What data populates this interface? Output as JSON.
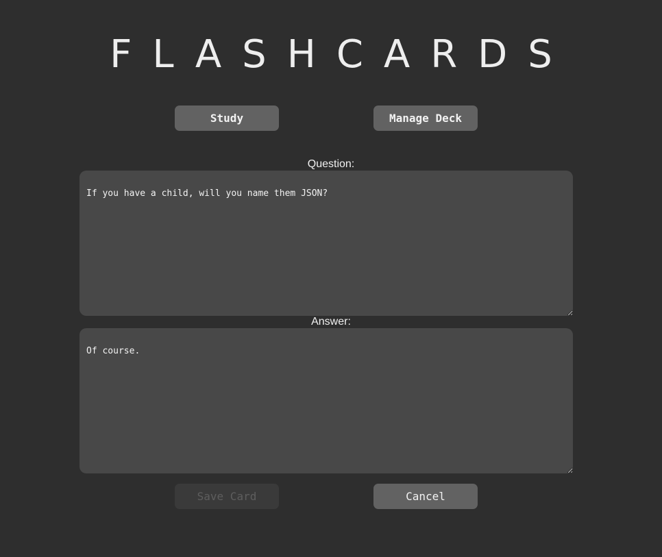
{
  "app": {
    "title": "FLASHCARDS"
  },
  "nav": {
    "study_label": "Study",
    "manage_label": "Manage Deck"
  },
  "form": {
    "question_label": "Question:",
    "question_value": "If you have a child, will you name them JSON?",
    "answer_label": "Answer:",
    "answer_value": "Of course.",
    "save_label": "Save Card",
    "save_disabled": true,
    "cancel_label": "Cancel"
  },
  "colors": {
    "background": "#2e2e2e",
    "button": "#626262",
    "button_disabled": "#3a3a3a",
    "field": "#484848",
    "text": "#eeeeee"
  }
}
